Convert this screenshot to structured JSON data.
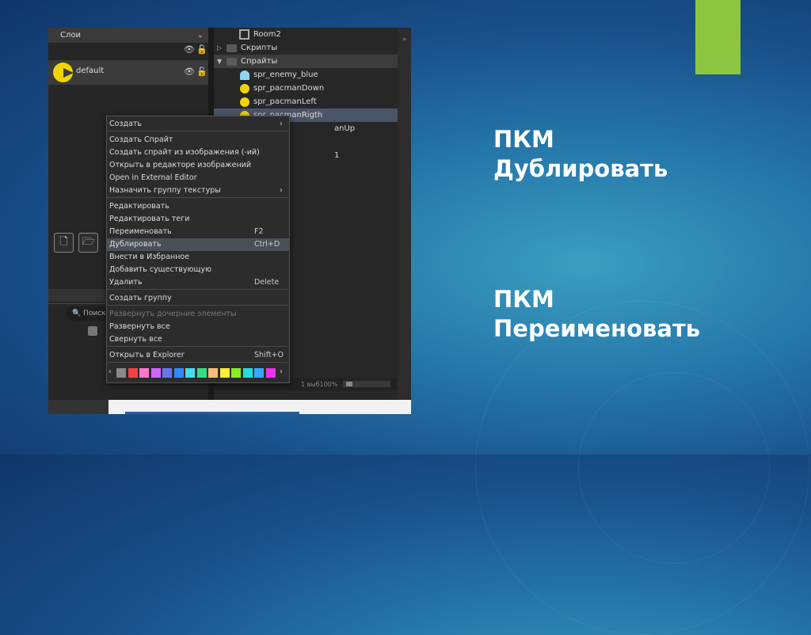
{
  "slide": {
    "accent_color": "#8cc63f",
    "commands": [
      {
        "line1": "ПКМ",
        "line2": "Дублировать"
      },
      {
        "line1": "ПКМ",
        "line2": "Переименовать"
      }
    ]
  },
  "layers_panel": {
    "header": "Слои",
    "layer_name": "default",
    "search_placeholder": "Поиск"
  },
  "asset_tree": [
    {
      "label": "Room2",
      "icon": "room-icon"
    },
    {
      "label": "Скрипты",
      "icon": "folder-icon"
    },
    {
      "label": "Спрайты",
      "icon": "folder-icon"
    },
    {
      "label": "spr_enemy_blue",
      "icon": "ghost-icon"
    },
    {
      "label": "spr_pacmanDown",
      "icon": "pacman-icon"
    },
    {
      "label": "spr_pacmanLeft",
      "icon": "pacman-icon"
    },
    {
      "label": "spr_pacmanRigth",
      "icon": "pacman-icon"
    },
    {
      "label": "anUp",
      "icon": ""
    },
    {
      "label": "1",
      "icon": ""
    }
  ],
  "status_bar": {
    "text": "1 выб100%"
  },
  "context_menu": {
    "items": [
      {
        "label": "Создать",
        "shortcut": "",
        "submenu": true
      },
      {
        "label": "Создать Спрайт",
        "shortcut": ""
      },
      {
        "label": "Создать спрайт из изображения (-ий)",
        "shortcut": ""
      },
      {
        "label": "Открыть в редакторе изображений",
        "shortcut": ""
      },
      {
        "label": "Open in External Editor",
        "shortcut": ""
      },
      {
        "label": "Назначить группу текстуры",
        "shortcut": "",
        "submenu": true
      },
      {
        "label": "Редактировать",
        "shortcut": ""
      },
      {
        "label": "Редактировать теги",
        "shortcut": ""
      },
      {
        "label": "Переименовать",
        "shortcut": "F2"
      },
      {
        "label": "Дублировать",
        "shortcut": "Ctrl+D",
        "active": true
      },
      {
        "label": "Внести в Избранное",
        "shortcut": ""
      },
      {
        "label": "Добавить существующую",
        "shortcut": ""
      },
      {
        "label": "Удалить",
        "shortcut": "Delete"
      },
      {
        "label": "Создать группу",
        "shortcut": ""
      },
      {
        "label": "Развернуть дочерние элементы",
        "shortcut": "",
        "disabled": true
      },
      {
        "label": "Развернуть все",
        "shortcut": ""
      },
      {
        "label": "Свернуть все",
        "shortcut": ""
      },
      {
        "label": "Открыть в Explorer",
        "shortcut": "Shift+O"
      }
    ],
    "swatch_colors": [
      "#888888",
      "#ee4444",
      "#ff77cc",
      "#cc66ff",
      "#6677ee",
      "#3388ff",
      "#44ddee",
      "#33dd88",
      "#ffbb77",
      "#ffee33",
      "#88ee22",
      "#22dddd",
      "#33aaff",
      "#ee33ee"
    ]
  }
}
